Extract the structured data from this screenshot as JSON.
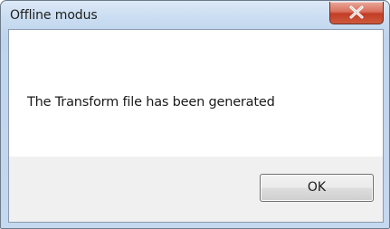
{
  "window": {
    "title": "Offline modus"
  },
  "message": {
    "text": "The Transform file has been generated"
  },
  "buttons": {
    "ok_label": "OK"
  },
  "icons": {
    "close": "close-icon"
  },
  "colors": {
    "close_button": "#c9483a",
    "frame": "#c4d8ef",
    "button_area": "#f0f0f0"
  }
}
